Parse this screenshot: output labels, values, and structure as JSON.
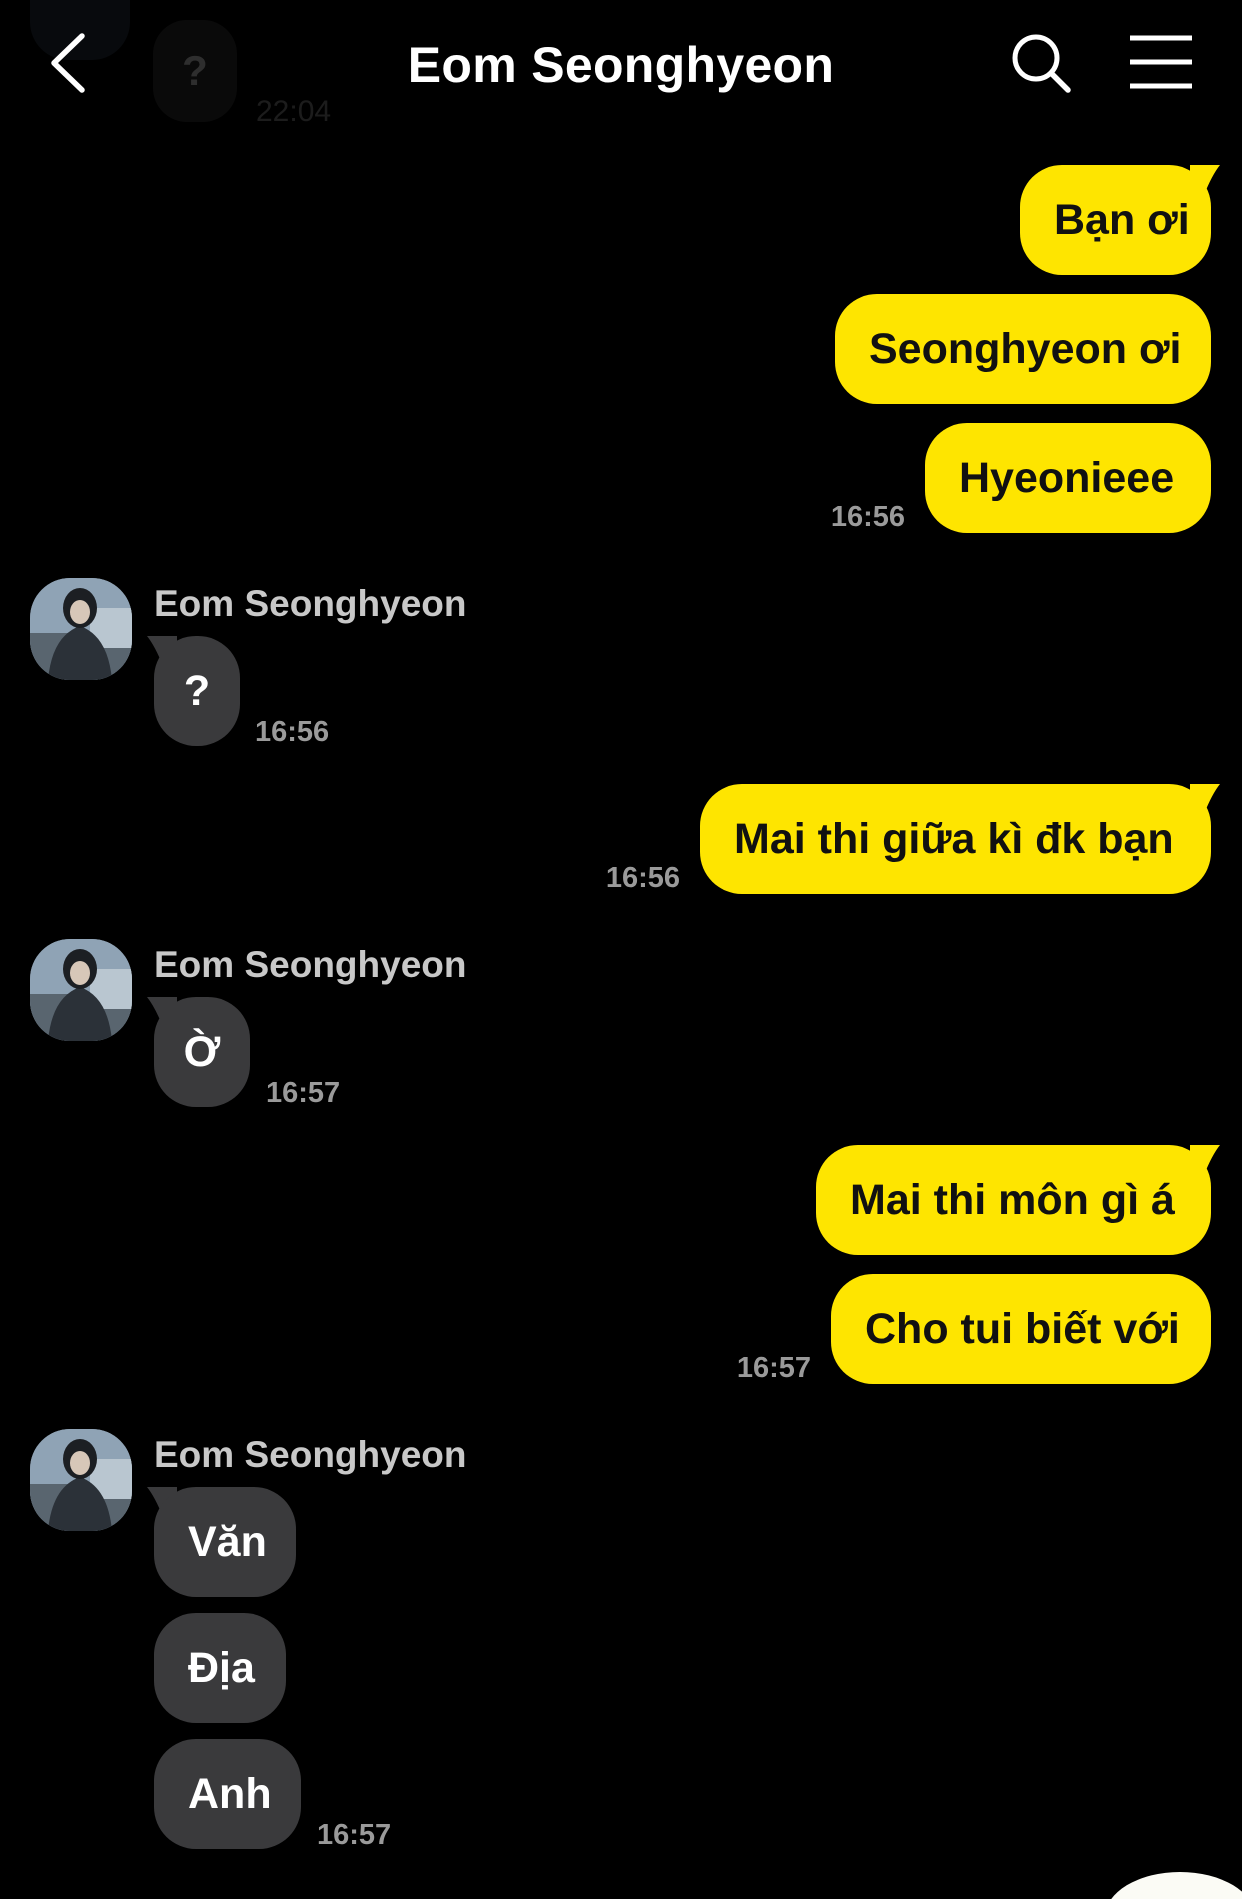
{
  "header": {
    "title": "Eom Seonghyeon"
  },
  "ghost": {
    "bubble": "?",
    "time": "22:04"
  },
  "colors": {
    "outgoing": "#fee500",
    "incoming": "#3a3a3c",
    "background": "#000000"
  },
  "messages": [
    {
      "text": "Bạn ơi"
    },
    {
      "text": "Seonghyeon ơi"
    },
    {
      "text": "Hyeonieee",
      "time": "16:56"
    },
    {
      "sender": "Eom Seonghyeon",
      "text": "?",
      "time": "16:56"
    },
    {
      "text": "Mai thi giữa kì đk bạn",
      "time": "16:56"
    },
    {
      "sender": "Eom Seonghyeon",
      "text": "Ờ",
      "time": "16:57"
    },
    {
      "text": "Mai thi môn gì á"
    },
    {
      "text": "Cho tui biết với",
      "time": "16:57"
    },
    {
      "sender": "Eom Seonghyeon",
      "text": "Văn"
    },
    {
      "text": "Địa"
    },
    {
      "text": "Anh",
      "time": "16:57"
    }
  ]
}
